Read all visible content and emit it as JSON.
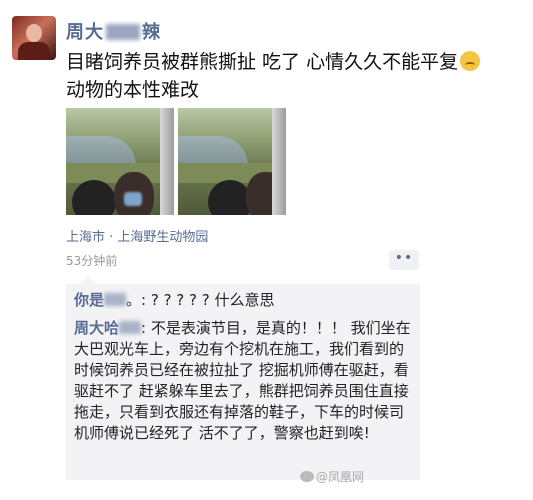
{
  "post": {
    "author_name_prefix": "周大",
    "author_name_suffix": "辣",
    "text_part1": "目睹饲养员被群熊撕扯 吃了 心情久久不能平复",
    "text_part2": " 动物的本性难改",
    "location": "上海市 · 上海野生动物园",
    "time": "53分钟前",
    "more_label": "••"
  },
  "comments": [
    {
      "author": "你是",
      "text": "。: ? ? ? ? ? 什么意思"
    },
    {
      "author": "周大哈",
      "text": ": 不是表演节目，是真的！！！ 我们坐在大巴观光车上，旁边有个挖机在施工，我们看到的时候饲养员已经在被拉扯了 挖掘机师傅在驱赶，看驱赶不了 赶紧躲车里去了，熊群把饲养员围住直接拖走，只看到衣服还有掉落的鞋子，下车的时候司机师傅说已经死了 活不了了，警察也赶到唉!"
    }
  ],
  "watermark": "@凤凰网"
}
